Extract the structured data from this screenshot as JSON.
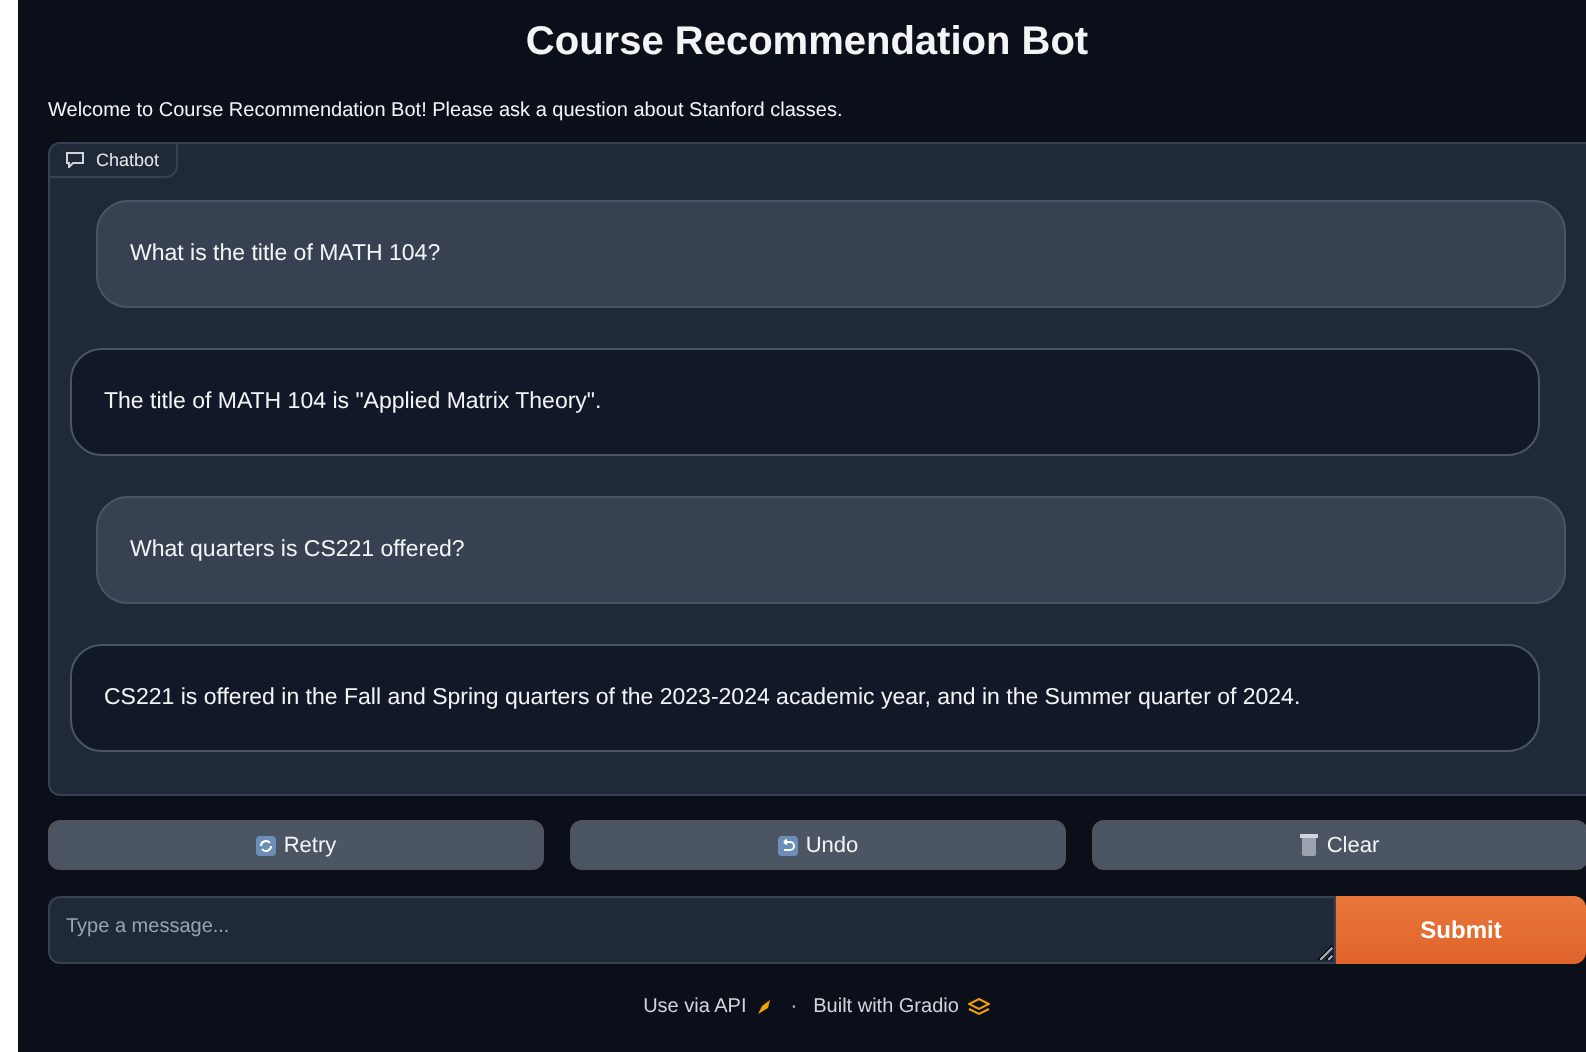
{
  "title": "Course Recommendation Bot",
  "description": "Welcome to Course Recommendation Bot! Please ask a question about Stanford classes.",
  "chatbot": {
    "label": "Chatbot",
    "messages": [
      {
        "kind": "user",
        "text": "What is the title of MATH 104?"
      },
      {
        "kind": "bot",
        "text": "The title of MATH 104 is \"Applied Matrix Theory\"."
      },
      {
        "kind": "user",
        "text": "What quarters is CS221 offered?"
      },
      {
        "kind": "bot",
        "text": "CS221 is offered in the Fall and Spring quarters of the 2023-2024 academic year, and in the Summer quarter of 2024."
      }
    ]
  },
  "buttons": [
    {
      "kind": "retry",
      "label": "Retry"
    },
    {
      "kind": "undo",
      "label": "Undo"
    },
    {
      "kind": "clear",
      "label": "Clear"
    }
  ],
  "input": {
    "placeholder": "Type a message..."
  },
  "submit": "Submit",
  "footer": {
    "api": "Use via API",
    "separator": "·",
    "built": "Built with Gradio"
  }
}
